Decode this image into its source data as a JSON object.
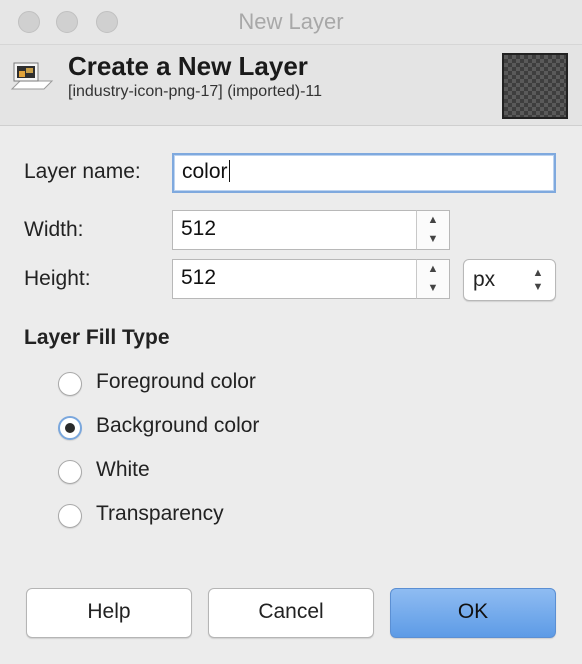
{
  "window": {
    "title": "New Layer"
  },
  "header": {
    "title": "Create a New Layer",
    "subtitle": "[industry-icon-png-17] (imported)-11",
    "icon": "layer-icon",
    "thumbnail": "layer-thumbnail"
  },
  "form": {
    "layer_name_label": "Layer name:",
    "layer_name_value": "color",
    "width_label": "Width:",
    "width_value": "512",
    "height_label": "Height:",
    "height_value": "512",
    "unit_value": "px"
  },
  "fill_type": {
    "title": "Layer Fill Type",
    "options": [
      {
        "label": "Foreground color",
        "checked": false
      },
      {
        "label": "Background color",
        "checked": true
      },
      {
        "label": "White",
        "checked": false
      },
      {
        "label": "Transparency",
        "checked": false
      }
    ]
  },
  "buttons": {
    "help": "Help",
    "cancel": "Cancel",
    "ok": "OK"
  },
  "colors": {
    "accent": "#5d9be6",
    "focus_ring": "#7fa9de"
  }
}
